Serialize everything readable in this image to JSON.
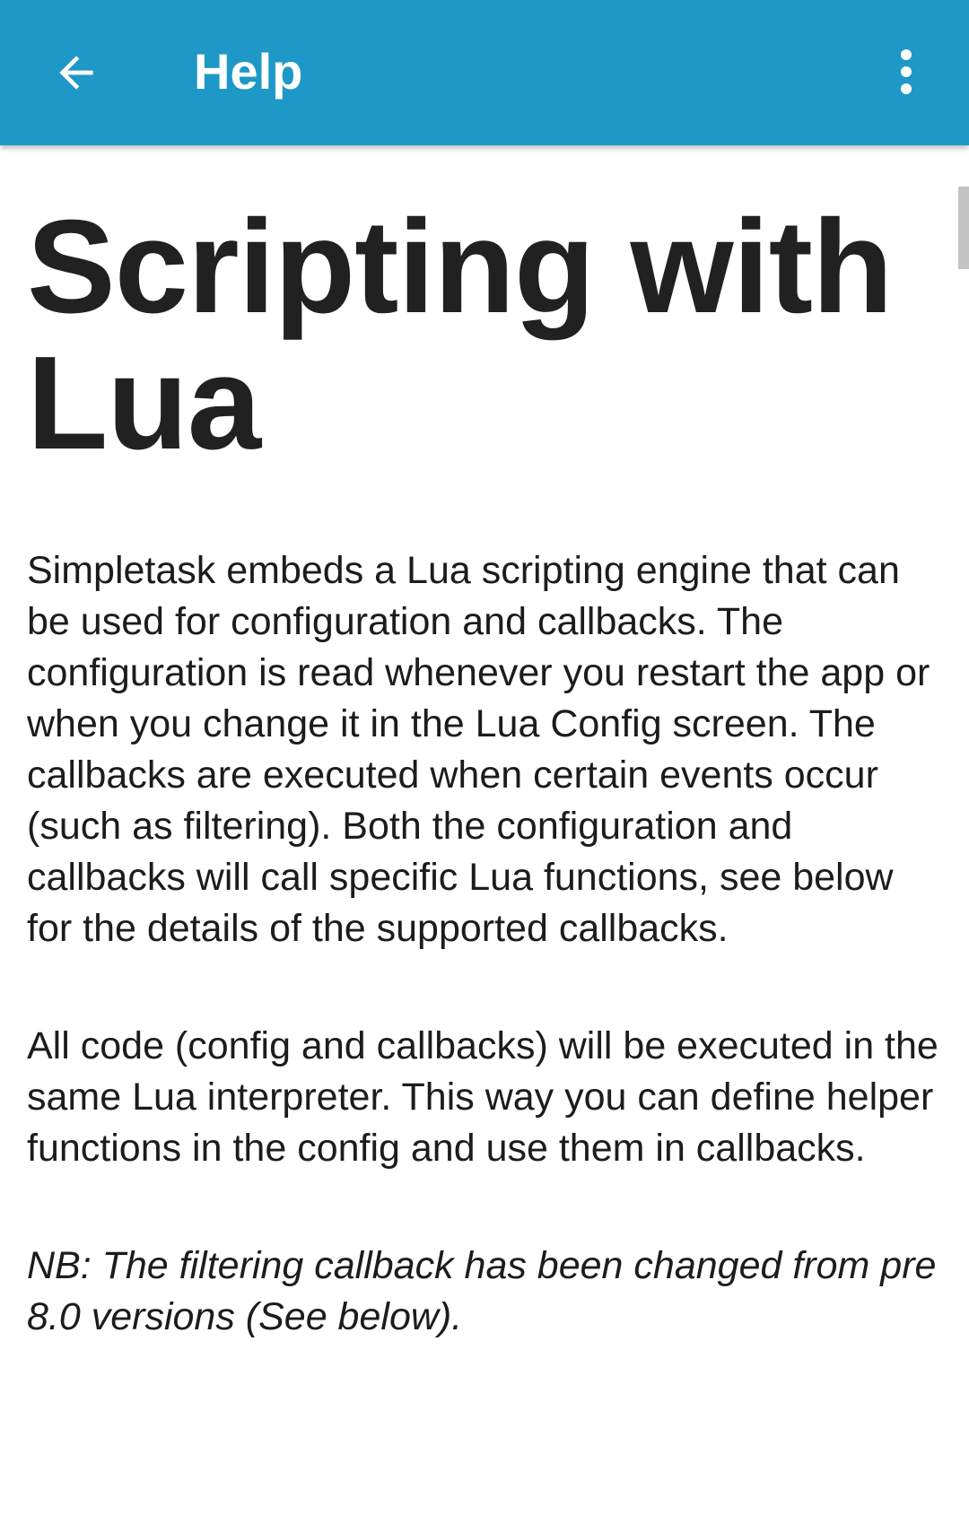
{
  "toolbar": {
    "title": "Help",
    "back_icon": "arrow-left-icon",
    "menu_icon": "more-vertical-icon",
    "background_color": "#1e98c6"
  },
  "content": {
    "heading": "Scripting with Lua",
    "paragraphs": [
      "Simpletask embeds a Lua scripting engine that can be used for configuration and callbacks. The configuration is read whenever you restart the app or when you change it in the Lua Config screen. The callbacks are executed when certain events occur (such as filtering). Both the configuration and callbacks will call specific Lua functions, see below for the details of the supported callbacks.",
      "All code (config and callbacks) will be executed in the same Lua interpreter. This way you can define helper functions in the config and use them in callbacks.",
      "NB: The filtering callback has been changed from pre 8.0 versions (See below)."
    ]
  }
}
